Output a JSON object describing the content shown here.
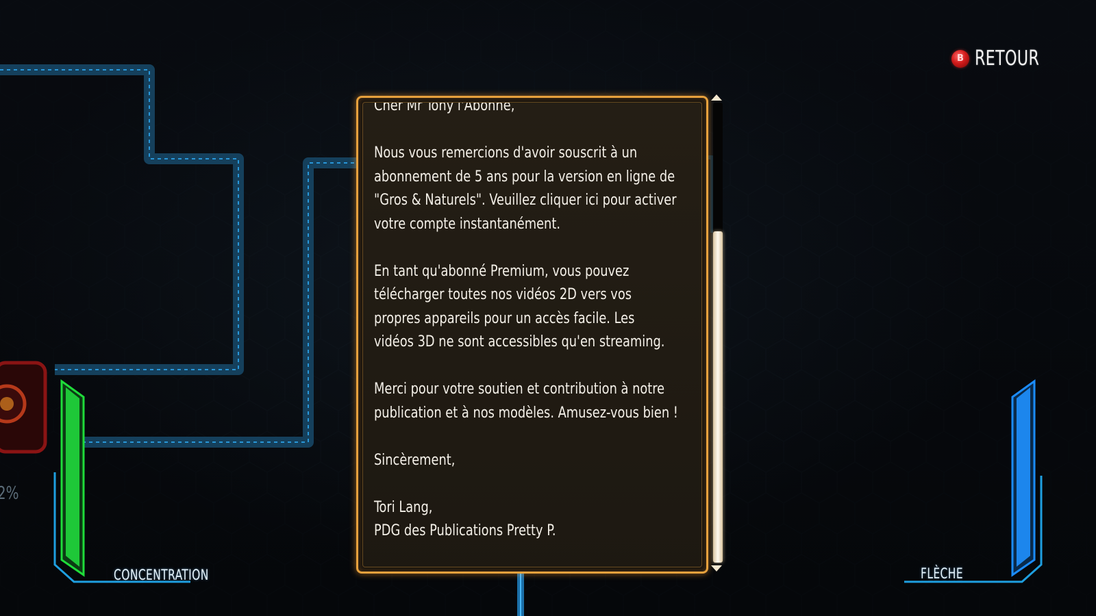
{
  "header": {
    "back_button_icon": "B",
    "back_button_label": "RETOUR"
  },
  "message": {
    "body": "Cher Mr Tony l'Abonné,\n\nNous vous remercions d'avoir souscrit à un\nabonnement de 5 ans pour la version en ligne de\n\"Gros & Naturels\". Veuillez cliquer ici pour activer\nvotre compte instantanément.\n\nEn tant qu'abonné Premium, vous pouvez\ntélécharger toutes nos vidéos 2D vers vos\npropres appareils pour un accès facile. Les\nvidéos 3D ne sont accessibles qu'en streaming.\n\nMerci pour votre soutien et contribution à notre\npublication et à nos modèles. Amusez-vous bien !\n\nSincèrement,\n\nTori Lang,\nPDG des Publications Pretty P."
  },
  "scrollbar": {
    "position_fraction": 1.0,
    "thumb_fraction": 0.72
  },
  "hud": {
    "left_gauge_label": "CONCENTRATION",
    "right_gauge_label": "FLÈCHE",
    "left_gauge_color": "#1fdc3a",
    "right_gauge_color": "#1b8cff",
    "partial_percent_text": "2%"
  },
  "colors": {
    "panel_border": "#e7a13d",
    "circuit": "#1e90d6",
    "back_icon": "#d21b1b"
  }
}
